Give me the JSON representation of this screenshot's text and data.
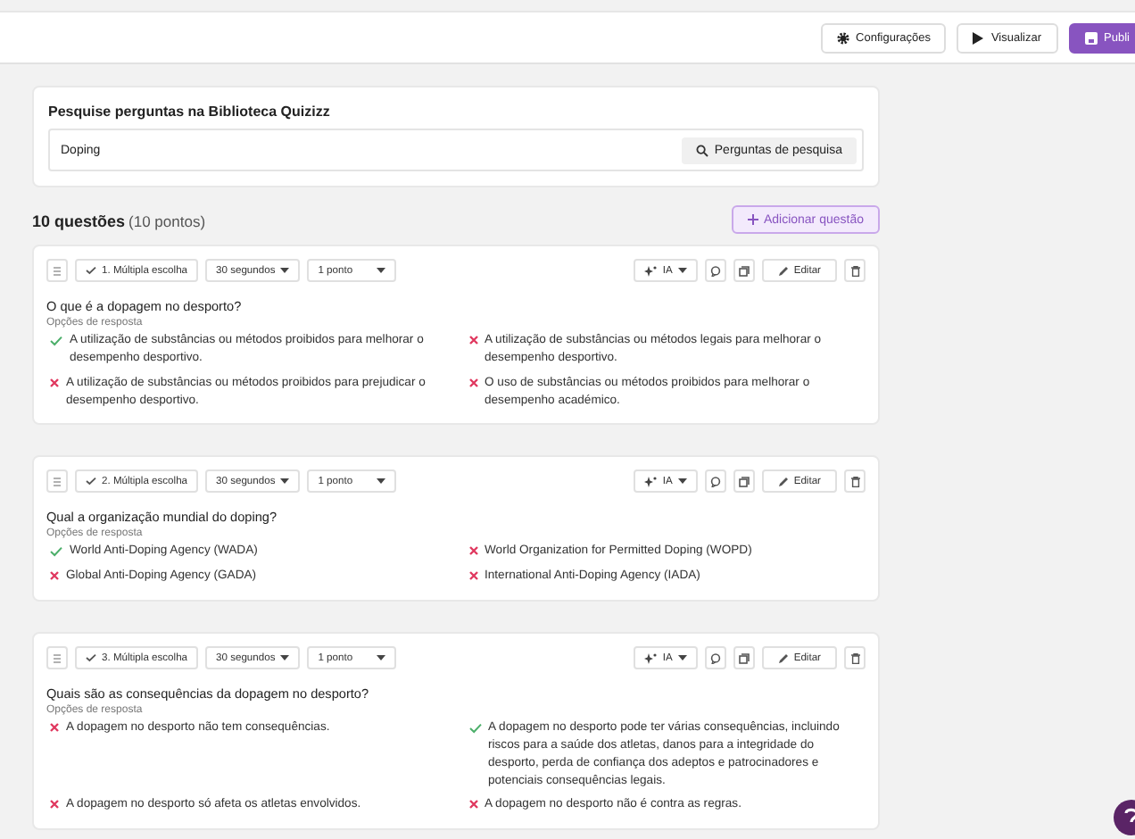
{
  "toolbar": [
    {
      "kind": "settings",
      "label": "Configurações"
    },
    {
      "kind": "play",
      "label": "Visualizar"
    },
    {
      "kind": "publish",
      "label": "Publi"
    }
  ],
  "search": {
    "title": "Pesquise perguntas na Biblioteca Quizizz",
    "value": "Doping",
    "button": "Perguntas de pesquisa"
  },
  "summary": {
    "count": "10 questões",
    "points": "(10 pontos)",
    "add_button": "Adicionar questão"
  },
  "questions": [
    {
      "type": "1. Múltipla escolha",
      "time": "30 segundos",
      "points": "1 ponto",
      "ai": "IA",
      "edit": "Editar",
      "text": "O que é a dopagem no desporto?",
      "options_label": "Opções de resposta",
      "answers": [
        {
          "text": "A utilização de substâncias ou métodos proibidos para melhorar o desempenho desportivo.",
          "correct": true
        },
        {
          "text": "A utilização de substâncias ou métodos legais para melhorar o desempenho desportivo.",
          "correct": false
        },
        {
          "text": "A utilização de substâncias ou métodos proibidos para prejudicar o desempenho desportivo.",
          "correct": false
        },
        {
          "text": "O uso de substâncias ou métodos proibidos para melhorar o desempenho académico.",
          "correct": false
        }
      ]
    },
    {
      "type": "2. Múltipla escolha",
      "time": "30 segundos",
      "points": "1 ponto",
      "ai": "IA",
      "edit": "Editar",
      "text": "Qual a organização mundial do doping?",
      "options_label": "Opções de resposta",
      "answers": [
        {
          "text": "World Anti-Doping Agency (WADA)",
          "correct": true
        },
        {
          "text": "World Organization for Permitted Doping (WOPD)",
          "correct": false
        },
        {
          "text": "Global Anti-Doping Agency (GADA)",
          "correct": false
        },
        {
          "text": "International Anti-Doping Agency (IADA)",
          "correct": false
        }
      ]
    },
    {
      "type": "3. Múltipla escolha",
      "time": "30 segundos",
      "points": "1 ponto",
      "ai": "IA",
      "edit": "Editar",
      "text": "Quais são as consequências da dopagem no desporto?",
      "options_label": "Opções de resposta",
      "answers": [
        {
          "text": "A dopagem no desporto não tem consequências.",
          "correct": false
        },
        {
          "text": "A dopagem no desporto pode ter várias consequências, incluindo riscos para a saúde dos atletas, danos para a integridade do desporto, perda de confiança dos adeptos e patrocinadores e potenciais consequências legais.",
          "correct": true
        },
        {
          "text": "A dopagem no desporto só afeta os atletas envolvidos.",
          "correct": false
        },
        {
          "text": "A dopagem no desporto não é contra as regras.",
          "correct": false
        }
      ]
    }
  ]
}
